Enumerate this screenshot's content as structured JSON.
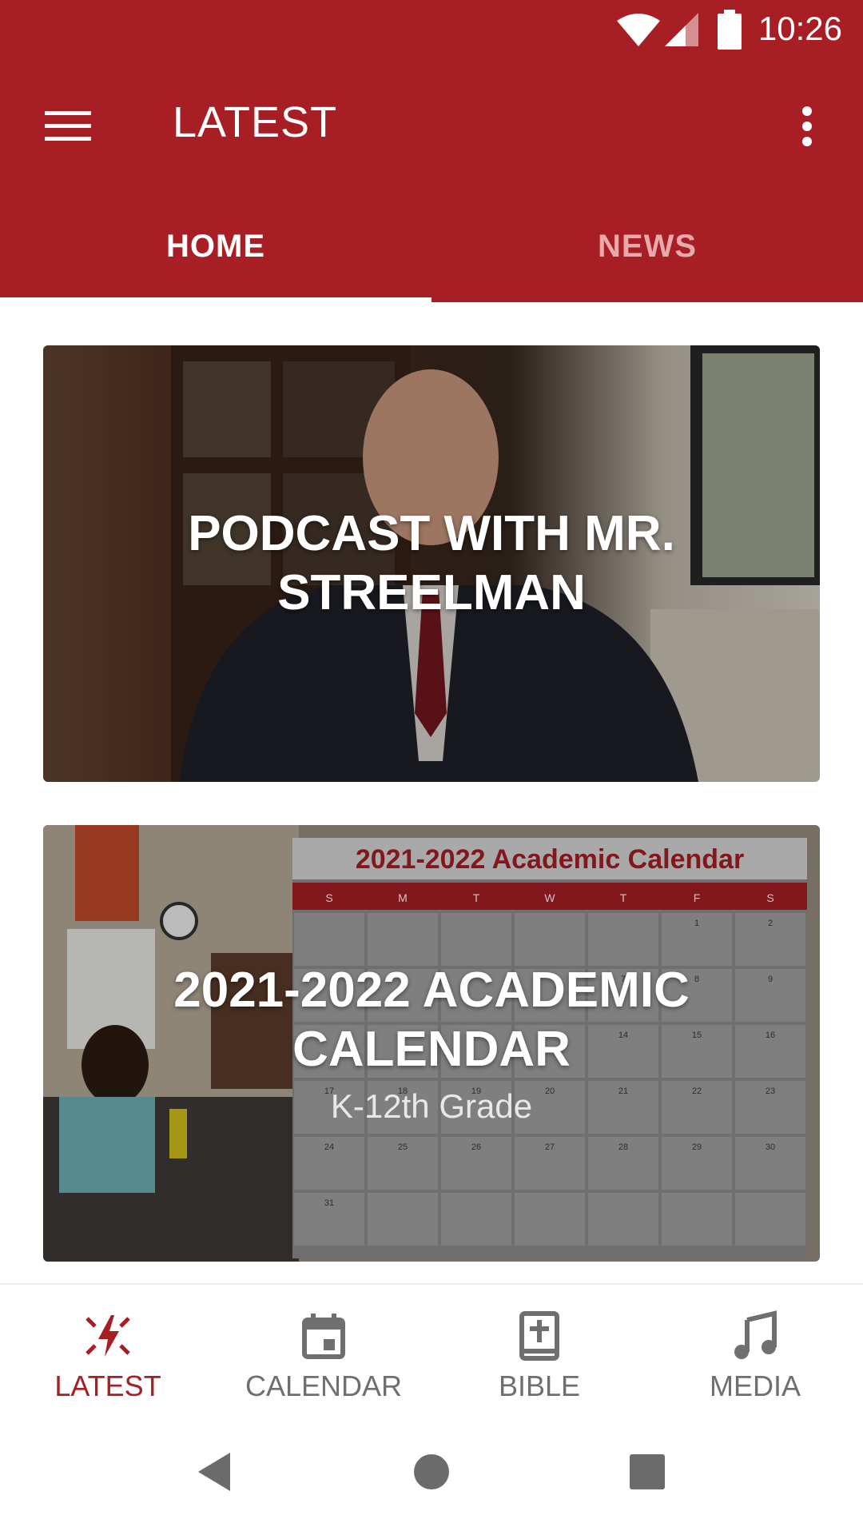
{
  "status_bar": {
    "time": "10:26"
  },
  "app_bar": {
    "title": "LATEST",
    "tabs": [
      {
        "label": "HOME",
        "active": true
      },
      {
        "label": "NEWS",
        "active": false
      }
    ]
  },
  "cards": [
    {
      "title_line1": "PODCAST WITH MR.",
      "title_line2": "STREELMAN",
      "subtitle": ""
    },
    {
      "title_line1": "2021-2022 ACADEMIC",
      "title_line2": "CALENDAR",
      "subtitle": "K-12th Grade",
      "image_heading": "2021-2022 Academic Calendar",
      "weekdays": [
        "S",
        "M",
        "T",
        "W",
        "T",
        "F",
        "S"
      ],
      "dates": [
        [
          "",
          "",
          "",
          "",
          "",
          "1",
          "2"
        ],
        [
          "",
          "",
          "",
          "",
          "7",
          "8",
          "9"
        ],
        [
          "",
          "",
          "",
          "",
          "14",
          "15",
          "16"
        ],
        [
          "17",
          "18",
          "19",
          "20",
          "21",
          "22",
          "23"
        ],
        [
          "24",
          "25",
          "26",
          "27",
          "28",
          "29",
          "30"
        ],
        [
          "31",
          "",
          "",
          "",
          "",
          "",
          ""
        ]
      ]
    }
  ],
  "bottom_nav": [
    {
      "label": "LATEST",
      "icon": "latest-icon",
      "active": true
    },
    {
      "label": "CALENDAR",
      "icon": "calendar-icon",
      "active": false
    },
    {
      "label": "BIBLE",
      "icon": "bible-icon",
      "active": false
    },
    {
      "label": "MEDIA",
      "icon": "music-note-icon",
      "active": false
    }
  ],
  "colors": {
    "primary": "#a71e25",
    "inactive_tab": "#e7a9ac",
    "inactive_nav": "#6f6f6f"
  }
}
